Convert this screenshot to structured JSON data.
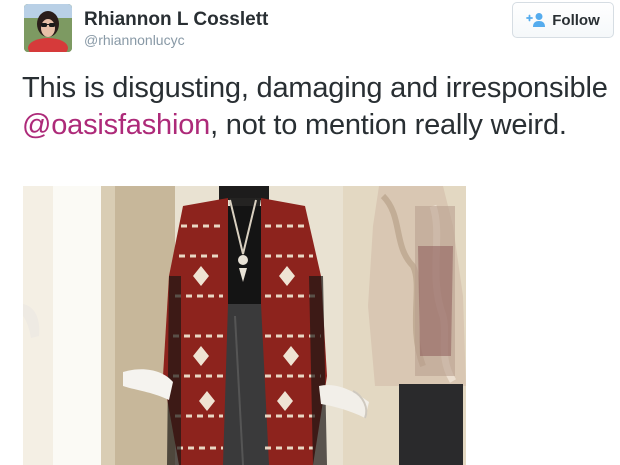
{
  "user": {
    "display_name": "Rhiannon L Cosslett",
    "handle": "@rhiannonlucyc"
  },
  "follow_button": {
    "label": "Follow",
    "icon": "add-person-icon",
    "accent": "#55acee"
  },
  "tweet": {
    "text_before": "This is disgusting, damaging and irresponsible ",
    "mention": "@oasisfashion",
    "text_after": ", not to mention really weird.",
    "mention_color": "#ad2a79"
  },
  "media": {
    "icon": "photo-of-mannequins-in-store"
  }
}
